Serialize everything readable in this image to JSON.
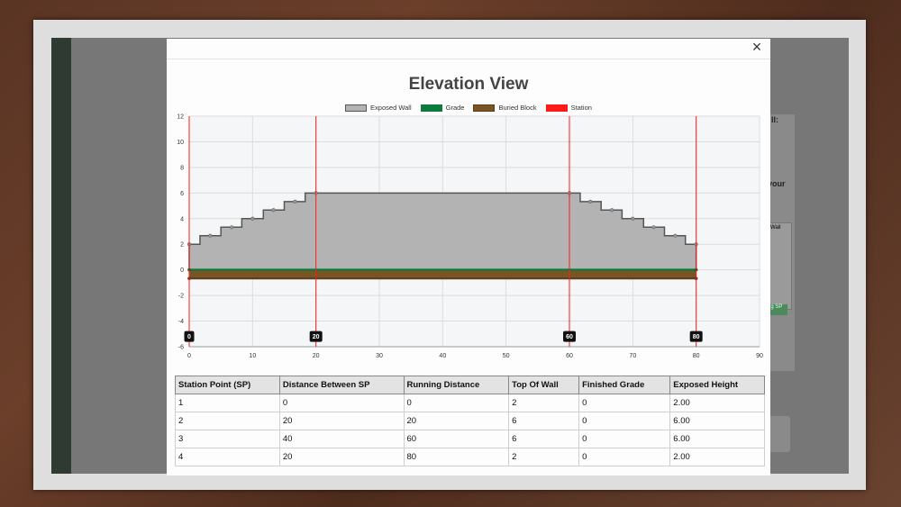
{
  "modal": {
    "title": "Elevation View",
    "close_glyph": "×"
  },
  "legend": [
    {
      "label": "Exposed Wall",
      "color": "#b3b3b3",
      "border": "#555555"
    },
    {
      "label": "Grade",
      "color": "#0c7a3a",
      "border": "#0c7a3a"
    },
    {
      "label": "Buried Block",
      "color": "#7a5424",
      "border": "#5a3c18"
    },
    {
      "label": "Station",
      "color": "#ff1a1a",
      "border": "#ff1a1a"
    }
  ],
  "chart_data": {
    "type": "area",
    "xlim": [
      0,
      90
    ],
    "ylim": [
      -6,
      12
    ],
    "x_ticks": [
      0,
      10,
      20,
      30,
      40,
      50,
      60,
      70,
      80,
      90
    ],
    "y_ticks": [
      -6,
      -4,
      -2,
      0,
      2,
      4,
      6,
      8,
      10,
      12
    ],
    "grid": true,
    "legend_position": "top",
    "series": [
      {
        "name": "Exposed Wall",
        "points": [
          [
            0,
            2
          ],
          [
            1.7,
            2
          ],
          [
            1.7,
            2.67
          ],
          [
            3.3,
            2.67
          ],
          [
            5,
            2.67
          ],
          [
            5,
            3.33
          ],
          [
            6.7,
            3.33
          ],
          [
            8.3,
            3.33
          ],
          [
            8.3,
            4
          ],
          [
            10,
            4
          ],
          [
            11.7,
            4
          ],
          [
            11.7,
            4.67
          ],
          [
            13.3,
            4.67
          ],
          [
            15,
            4.67
          ],
          [
            15,
            5.33
          ],
          [
            16.7,
            5.33
          ],
          [
            18.3,
            5.33
          ],
          [
            18.3,
            6
          ],
          [
            20,
            6
          ],
          [
            60,
            6
          ],
          [
            61.7,
            6
          ],
          [
            61.7,
            5.33
          ],
          [
            63.3,
            5.33
          ],
          [
            65,
            5.33
          ],
          [
            65,
            4.67
          ],
          [
            66.7,
            4.67
          ],
          [
            68.3,
            4.67
          ],
          [
            68.3,
            4
          ],
          [
            70,
            4
          ],
          [
            71.7,
            4
          ],
          [
            71.7,
            3.33
          ],
          [
            73.3,
            3.33
          ],
          [
            75,
            3.33
          ],
          [
            75,
            2.67
          ],
          [
            76.7,
            2.67
          ],
          [
            78.3,
            2.67
          ],
          [
            78.3,
            2
          ],
          [
            80,
            2
          ]
        ],
        "markers": [
          [
            0,
            2
          ],
          [
            3.3,
            2.67
          ],
          [
            6.7,
            3.33
          ],
          [
            10,
            4
          ],
          [
            13.3,
            4.67
          ],
          [
            16.7,
            5.33
          ],
          [
            20,
            6
          ],
          [
            60,
            6
          ],
          [
            63.3,
            5.33
          ],
          [
            66.7,
            4.67
          ],
          [
            70,
            4
          ],
          [
            73.3,
            3.33
          ],
          [
            76.7,
            2.67
          ],
          [
            80,
            2
          ]
        ]
      },
      {
        "name": "Grade",
        "y": 0,
        "x_range": [
          0,
          80
        ]
      },
      {
        "name": "Buried Block",
        "y": -0.67,
        "x_range": [
          0,
          80
        ]
      },
      {
        "name": "Station",
        "x": [
          0,
          20,
          60,
          80
        ]
      }
    ],
    "station_labels": [
      "0",
      "20",
      "60",
      "80"
    ]
  },
  "table": {
    "headers": [
      "Station Point (SP)",
      "Distance Between SP",
      "Running Distance",
      "Top Of Wall",
      "Finished Grade",
      "Exposed Height"
    ],
    "rows": [
      [
        "1",
        "0",
        "0",
        "2",
        "0",
        "2.00"
      ],
      [
        "2",
        "20",
        "20",
        "6",
        "0",
        "6.00"
      ],
      [
        "3",
        "40",
        "60",
        "6",
        "0",
        "6.00"
      ],
      [
        "4",
        "20",
        "80",
        "2",
        "0",
        "2.00"
      ]
    ]
  },
  "background": {
    "text1": "ll:",
    "text2": "your",
    "table_header": "Wall",
    "button": "ng SP"
  }
}
